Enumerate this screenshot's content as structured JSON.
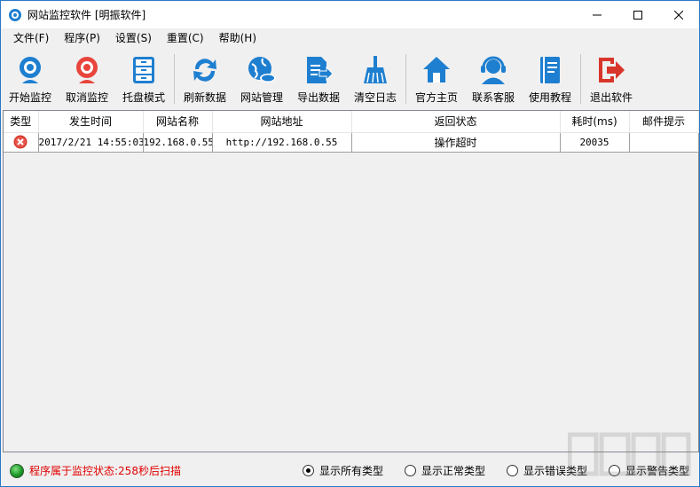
{
  "window": {
    "title": "网站监控软件 [明振软件]"
  },
  "menu": [
    {
      "label": "文件(F)"
    },
    {
      "label": "程序(P)"
    },
    {
      "label": "设置(S)"
    },
    {
      "label": "重置(C)"
    },
    {
      "label": "帮助(H)"
    }
  ],
  "toolbar": [
    {
      "label": "开始监控",
      "icon": "webcam-start-icon"
    },
    {
      "label": "取消监控",
      "icon": "webcam-stop-icon"
    },
    {
      "label": "托盘模式",
      "icon": "cabinet-icon"
    },
    {
      "label": "刷新数据",
      "icon": "refresh-icon"
    },
    {
      "label": "网站管理",
      "icon": "globe-cloud-icon"
    },
    {
      "label": "导出数据",
      "icon": "export-icon"
    },
    {
      "label": "清空日志",
      "icon": "broom-icon"
    },
    {
      "label": "官方主页",
      "icon": "home-icon"
    },
    {
      "label": "联系客服",
      "icon": "headset-icon"
    },
    {
      "label": "使用教程",
      "icon": "book-icon"
    },
    {
      "label": "退出软件",
      "icon": "exit-icon"
    }
  ],
  "colors": {
    "accent_blue": "#1e7fd0",
    "error_red": "#d9362b",
    "status_red": "#e00000",
    "status_green": "#1e9a2a"
  },
  "table": {
    "columns": [
      "类型",
      "发生时间",
      "网站名称",
      "网站地址",
      "返回状态",
      "耗时(ms)",
      "邮件提示"
    ],
    "rows": [
      {
        "type_icon": "error-icon",
        "time": "2017/2/21 14:55:03",
        "name": "192.168.0.55",
        "url": "http://192.168.0.55",
        "status": "操作超时",
        "elapsed": "20035",
        "mail": ""
      }
    ]
  },
  "statusbar": {
    "text": "程序属于监控状态:258秒后扫描",
    "filters": [
      {
        "label": "显示所有类型",
        "checked": true
      },
      {
        "label": "显示正常类型",
        "checked": false
      },
      {
        "label": "显示错误类型",
        "checked": false
      },
      {
        "label": "显示警告类型",
        "checked": false
      }
    ]
  }
}
